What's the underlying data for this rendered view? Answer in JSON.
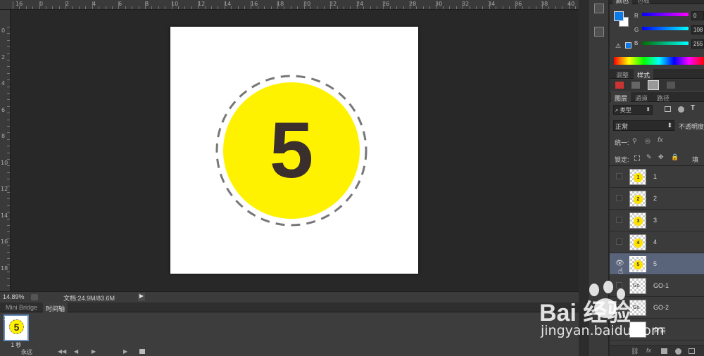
{
  "ruler": {
    "top_labels": [
      "16",
      "0",
      "2",
      "4",
      "6",
      "8",
      "10",
      "12",
      "14",
      "16",
      "18",
      "20",
      "22",
      "24",
      "26",
      "28",
      "30",
      "32",
      "34",
      "36",
      "38",
      "40"
    ],
    "left_labels": [
      "0",
      "2",
      "4",
      "6",
      "8",
      "10",
      "12",
      "14",
      "16",
      "18",
      "20"
    ]
  },
  "document": {
    "badge_number": "5",
    "circle_color": "#FFF200",
    "dash_color": "#777777",
    "number_color": "#3A2F2D"
  },
  "status": {
    "zoom": "14.89%",
    "doc_info": "文档:24.9M/83.6M"
  },
  "timeline": {
    "tabs": [
      "Mini Bridge",
      "时间轴"
    ],
    "active_tab": "时间轴",
    "frame_number": "1",
    "frame_badge": "5",
    "frame_duration": "1 秒",
    "loop_label": "永远"
  },
  "color_panel": {
    "tabs": [
      "颜色",
      "色板"
    ],
    "fg_color": "#0C7BE8",
    "bg_color": "#FFFFFF",
    "channels": [
      {
        "label": "R",
        "value": "0"
      },
      {
        "label": "G",
        "value": "108"
      },
      {
        "label": "B",
        "value": "255"
      }
    ]
  },
  "adjust_panel": {
    "tabs": [
      "调整",
      "样式"
    ],
    "active_tab": "样式"
  },
  "layers_panel": {
    "tabs": [
      "图层",
      "通道",
      "路径"
    ],
    "active_tab": "图层",
    "filter_label": "类型",
    "blend_mode": "正常",
    "opacity_label": "不透明度",
    "unify_label": "统一:",
    "lock_label": "锁定:",
    "fill_label": "填充",
    "layers": [
      {
        "name": "1",
        "thumb": "1",
        "selected": false,
        "visible": false
      },
      {
        "name": "2",
        "thumb": "2",
        "selected": false,
        "visible": false
      },
      {
        "name": "3",
        "thumb": "3",
        "selected": false,
        "visible": false
      },
      {
        "name": "4",
        "thumb": "4",
        "selected": false,
        "visible": false
      },
      {
        "name": "5",
        "thumb": "5",
        "selected": true,
        "visible": true
      },
      {
        "name": "GO-1",
        "thumb": "Go",
        "selected": false,
        "visible": false
      },
      {
        "name": "GO-2",
        "thumb": "Go",
        "selected": false,
        "visible": false
      },
      {
        "name": "背景",
        "thumb": "",
        "selected": false,
        "visible": false
      }
    ]
  },
  "watermark": {
    "brand": "Bai 经验",
    "url": "jingyan.baidu.com"
  }
}
